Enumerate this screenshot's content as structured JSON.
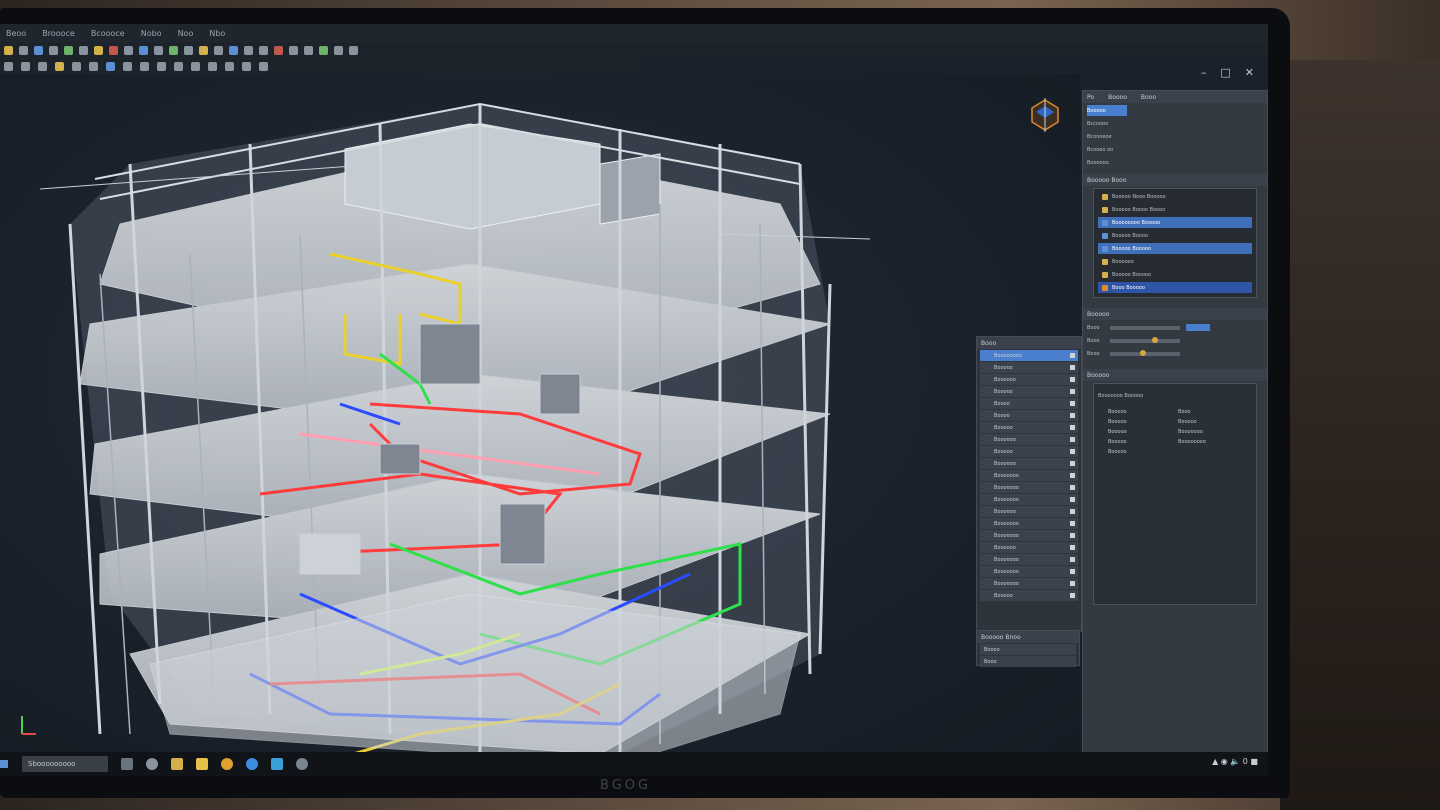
{
  "monitor": {
    "brand": "BGOG"
  },
  "menubar": {
    "items": [
      "Beoo",
      "Broooce",
      "Bcoooce",
      "Nobo",
      "Noo",
      "Nbo"
    ]
  },
  "window": {
    "minimize": "–",
    "maximize": "□",
    "close": "✕"
  },
  "taskbar": {
    "search_placeholder": "Sbooooooooo",
    "tray_text": "▲ ◉ 🔈 0 ■"
  },
  "right_panel": {
    "tab_labels": [
      "Po",
      "Boooo",
      "Booo"
    ],
    "browser_title": "Booooo",
    "browser_items": [
      "Bccoooo",
      "Bcoooeoe",
      "Bcooeo oo",
      "Boooooo"
    ],
    "layers_title": "Booooo Booo",
    "layer_rows": [
      "Booooo Nooo Booooo",
      "Booooo Boooo Boooo",
      "Boooooooo Booooo",
      "Booooo Boooo",
      "Booooo Booooo",
      "Boooooo",
      "Booooo Booooo",
      "Booo Booooo"
    ],
    "settings_title": "Booooo",
    "settings_rows": [
      "Booo",
      "Booo",
      "Booo"
    ],
    "props_title": "Booooo",
    "props_header": "Booooooo Booooo",
    "props": [
      {
        "k": "Booooo",
        "v": "Booo"
      },
      {
        "k": "Booooo",
        "v": "Booooo"
      },
      {
        "k": "Booooo",
        "v": "Booooooo"
      },
      {
        "k": "Booooo",
        "v": "Boooooooo"
      },
      {
        "k": "Booooo",
        "v": ""
      }
    ]
  },
  "side_list": {
    "title": "Booo",
    "rows": [
      "Boooooooo",
      "Booooo",
      "Boooooo",
      "Booooo",
      "Boooo",
      "Boooo",
      "Booooo",
      "Boooooo",
      "Booooo",
      "Boooooo",
      "Booooooo",
      "Booooooo",
      "Booooooo",
      "Boooooo",
      "Booooooo",
      "Booooooo",
      "Boooooo",
      "Booooooo",
      "Booooooo",
      "Booooooo",
      "Booooo"
    ],
    "footer_title": "Booooo Bnoo",
    "footer_rows": [
      "Boooo",
      "Booo"
    ]
  }
}
